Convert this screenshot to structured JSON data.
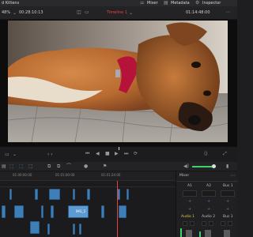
{
  "topbar": {
    "project_title": "d Kittens",
    "mixer_label": "Mixer",
    "metadata_label": "Metadata",
    "inspector_label": "Inspector"
  },
  "viewer_bar": {
    "zoom": "48%",
    "source_timecode": "00:28:10:13",
    "timeline_name": "Timeline 1",
    "record_timecode": "01:14:48:00"
  },
  "timeline": {
    "ruler_timecodes": [
      "01:00:00:00",
      "01:01:00:00",
      "01:01:24:00"
    ],
    "clip_label": "IMG_5"
  },
  "mixer": {
    "title": "Mixer",
    "channel_top": [
      "A1",
      "A2",
      "Bus 1"
    ],
    "channel_bottom": [
      "Audio 1",
      "Audio 2",
      "Bus 1"
    ]
  },
  "colors": {
    "accent_red": "#e8413a",
    "clip_blue": "#3f7fb8",
    "mixer_yellow": "#e1c84a",
    "level_green": "#3bd46c"
  }
}
